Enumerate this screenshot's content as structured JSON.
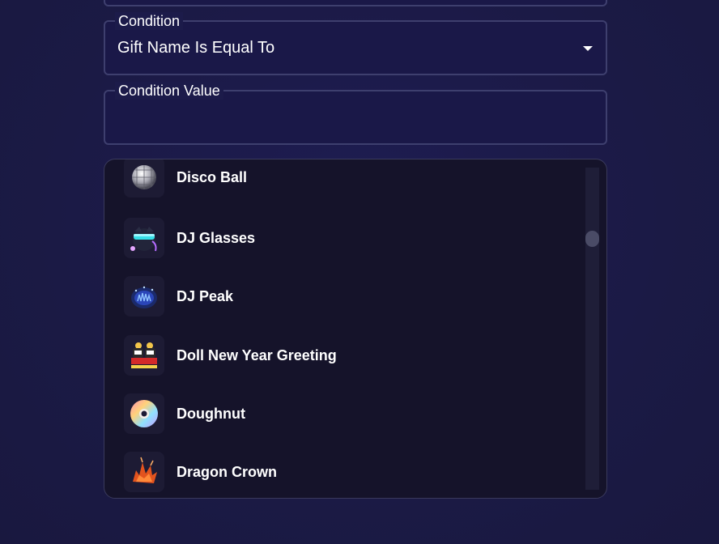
{
  "form": {
    "condition": {
      "label": "Condition",
      "value": "Gift Name Is Equal To"
    },
    "condition_value": {
      "label": "Condition Value",
      "value": ""
    }
  },
  "dropdown": {
    "items": [
      {
        "label": "Disco Ball",
        "icon": "disco-ball-icon"
      },
      {
        "label": "DJ Glasses",
        "icon": "dj-glasses-icon"
      },
      {
        "label": "DJ Peak",
        "icon": "dj-peak-icon"
      },
      {
        "label": "Doll New Year Greeting",
        "icon": "doll-new-year-greeting-icon"
      },
      {
        "label": "Doughnut",
        "icon": "doughnut-icon"
      },
      {
        "label": "Dragon Crown",
        "icon": "dragon-crown-icon"
      }
    ]
  },
  "colors": {
    "background": "#1c1b47",
    "field_border": "#3e3f6e",
    "dropdown_bg": "#15132a",
    "scroll_thumb": "#4a4b66"
  }
}
